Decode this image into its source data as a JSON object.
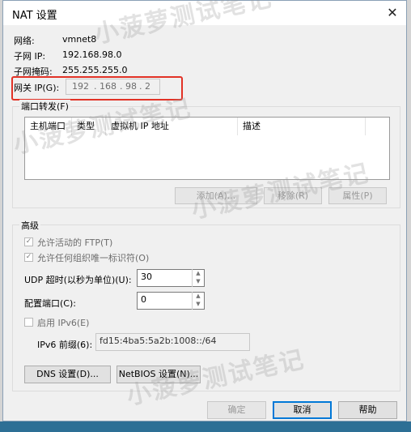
{
  "dialog": {
    "title": "NAT 设置",
    "close_glyph": "✕"
  },
  "info": {
    "network_label": "网络:",
    "network_value": "vmnet8",
    "subnet_ip_label": "子网 IP:",
    "subnet_ip_value": "192.168.98.0",
    "subnet_mask_label": "子网掩码:",
    "subnet_mask_value": "255.255.255.0",
    "gateway_label": "网关 IP(G):",
    "gateway_octets": [
      "192",
      "168",
      "98",
      "2"
    ],
    "gateway_dots": [
      "."
    ]
  },
  "port_forwarding": {
    "group_title": "端口转发(F)",
    "columns": [
      "主机端口",
      "类型",
      "虚拟机 IP 地址",
      "描述"
    ],
    "rows": [],
    "add_label": "添加(A)...",
    "remove_label": "移除(R)",
    "properties_label": "属性(P)"
  },
  "advanced": {
    "group_title": "高级",
    "allow_active_ftp": "允许活动的 FTP(T)",
    "allow_any_oui": "允许任何组织唯一标识符(O)",
    "udp_timeout_label": "UDP 超时(以秒为单位)(U):",
    "udp_timeout_value": "30",
    "config_port_label": "配置端口(C):",
    "config_port_value": "0",
    "enable_ipv6_label": "启用 IPv6(E)",
    "ipv6_prefix_label": "IPv6 前缀(6):",
    "ipv6_prefix_value": "fd15:4ba5:5a2b:1008::/64",
    "dns_button": "DNS 设置(D)...",
    "netbios_button": "NetBIOS 设置(N)..."
  },
  "footer": {
    "ok_label": "确定",
    "cancel_label": "取消",
    "help_label": "帮助"
  },
  "watermark": [
    "小菠萝测试笔记",
    "小菠萝测试笔记",
    "小菠萝测试笔记",
    "小菠萝测试笔记"
  ],
  "colors": {
    "highlight": "#e23226",
    "focus": "#0078d7"
  }
}
